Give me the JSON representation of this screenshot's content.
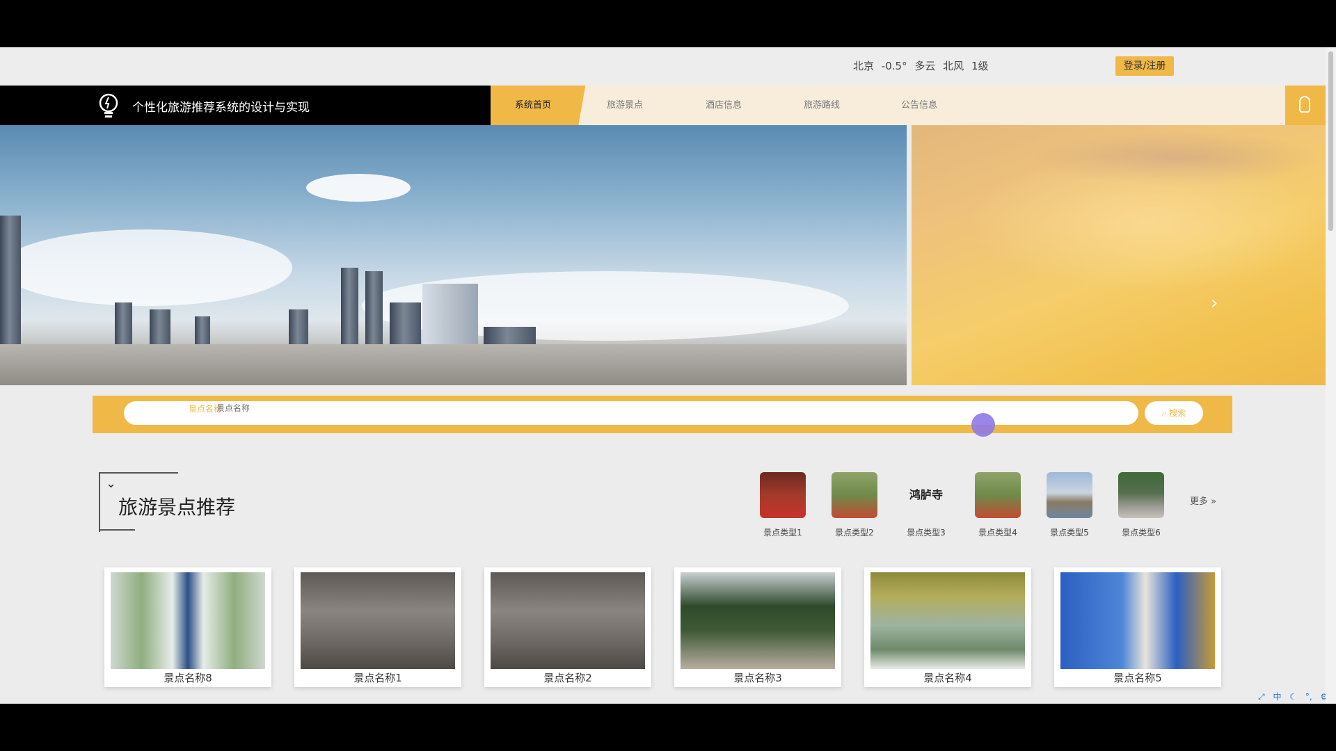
{
  "topbar": {
    "weather": {
      "city": "北京",
      "temp": "-0.5°",
      "condition": "多云",
      "wind": "北风",
      "level": "1级"
    },
    "login_label": "登录/注册"
  },
  "nav": {
    "brand_title": "个性化旅游推荐系统的设计与实现",
    "items": [
      {
        "label": "系统首页",
        "active": true
      },
      {
        "label": "旅游景点",
        "active": false
      },
      {
        "label": "酒店信息",
        "active": false
      },
      {
        "label": "旅游路线",
        "active": false
      },
      {
        "label": "公告信息",
        "active": false
      }
    ]
  },
  "search": {
    "select_value": "景点名称",
    "placeholder": "景点名称",
    "button_label": "搜索"
  },
  "section": {
    "title": "旅游景点推荐",
    "more_label": "更多 »",
    "categories": [
      {
        "label": "景点类型1"
      },
      {
        "label": "景点类型2"
      },
      {
        "label": "景点类型3",
        "thumb_text": "鸿胪寺"
      },
      {
        "label": "景点类型4"
      },
      {
        "label": "景点类型5"
      },
      {
        "label": "景点类型6"
      }
    ]
  },
  "cards": [
    {
      "name": "景点名称8"
    },
    {
      "name": "景点名称1"
    },
    {
      "name": "景点名称2"
    },
    {
      "name": "景点名称3"
    },
    {
      "name": "景点名称4"
    },
    {
      "name": "景点名称5"
    }
  ],
  "tray": {
    "ime_label": "中"
  },
  "colors": {
    "accent": "#f0b847",
    "nav_bg": "#f8eddb",
    "brand_bg": "#000000"
  }
}
